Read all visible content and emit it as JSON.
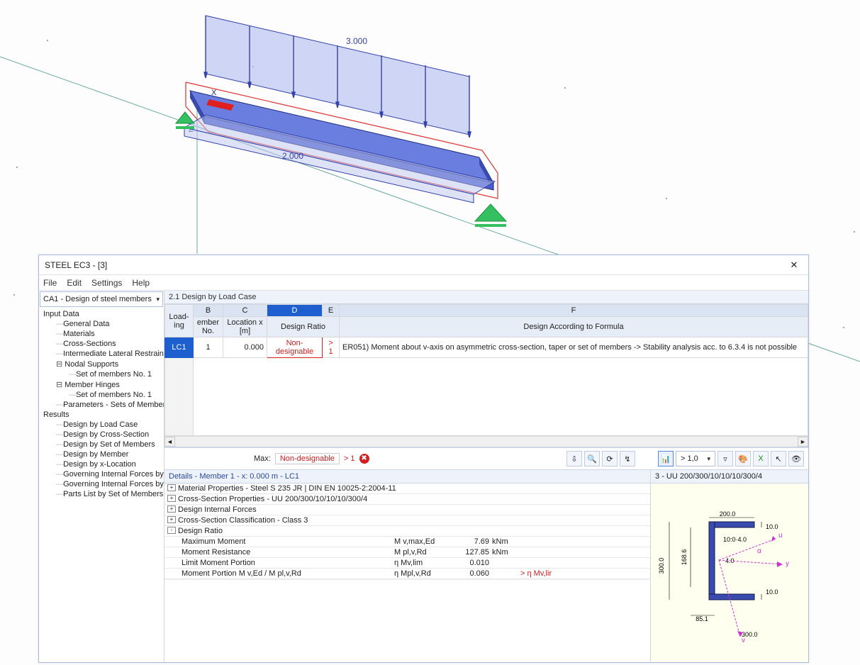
{
  "viewport": {
    "load_value": "3.000",
    "dim_value": "2.000",
    "axis_x": "X",
    "axis_z": "Z"
  },
  "window": {
    "title": "STEEL EC3 - [3]",
    "menus": [
      "File",
      "Edit",
      "Settings",
      "Help"
    ],
    "dropdown": "CA1 - Design of steel members",
    "tree": [
      {
        "label": "Input Data",
        "lvl": 1,
        "type": "plain"
      },
      {
        "label": "General Data",
        "lvl": 2,
        "type": "leaf"
      },
      {
        "label": "Materials",
        "lvl": 2,
        "type": "leaf"
      },
      {
        "label": "Cross-Sections",
        "lvl": 2,
        "type": "leaf"
      },
      {
        "label": "Intermediate Lateral Restraints",
        "lvl": 2,
        "type": "leaf"
      },
      {
        "label": "Nodal Supports",
        "lvl": 2,
        "type": "exp"
      },
      {
        "label": "Set of members No. 1",
        "lvl": 3,
        "type": "leaf"
      },
      {
        "label": "Member Hinges",
        "lvl": 2,
        "type": "exp"
      },
      {
        "label": "Set of members No. 1",
        "lvl": 3,
        "type": "leaf"
      },
      {
        "label": "Parameters - Sets of Members",
        "lvl": 2,
        "type": "leaf"
      },
      {
        "label": "Results",
        "lvl": 1,
        "type": "plain"
      },
      {
        "label": "Design by Load Case",
        "lvl": 2,
        "type": "leaf"
      },
      {
        "label": "Design by Cross-Section",
        "lvl": 2,
        "type": "leaf"
      },
      {
        "label": "Design by Set of Members",
        "lvl": 2,
        "type": "leaf"
      },
      {
        "label": "Design by Member",
        "lvl": 2,
        "type": "leaf"
      },
      {
        "label": "Design by x-Location",
        "lvl": 2,
        "type": "leaf"
      },
      {
        "label": "Governing Internal Forces by M",
        "lvl": 2,
        "type": "leaf"
      },
      {
        "label": "Governing Internal Forces by S",
        "lvl": 2,
        "type": "leaf"
      },
      {
        "label": "Parts List by Set of Members",
        "lvl": 2,
        "type": "leaf"
      }
    ],
    "section_title": "2.1 Design by Load Case",
    "grid": {
      "cols_letters": [
        "B",
        "C",
        "D",
        "E",
        "F"
      ],
      "headers": {
        "loading": "Load-\ning",
        "member": "ember\nNo.",
        "location": "Location\nx [m]",
        "design": "Design\nRatio",
        "formula": "Design According to Formula"
      },
      "row": {
        "load": "LC1",
        "member": "1",
        "x": "0.000",
        "ratio": "Non-designable",
        "gt": "> 1",
        "text": "ER051) Moment about v-axis on asymmetric cross-section, taper or set of members -> Stability analysis acc. to 6.3.4 is not possible"
      }
    },
    "maxbar": {
      "label": "Max:",
      "status": "Non-designable",
      "gt": "> 1",
      "scale": "> 1,0"
    },
    "details": {
      "title": "Details - Member 1 - x: 0.000 m - LC1",
      "nodes": [
        {
          "box": "+",
          "t": "Material Properties - Steel S 235 JR | DIN EN 10025-2:2004-11"
        },
        {
          "box": "+",
          "t": "Cross-Section Properties  -  UU 200/300/10/10/10/300/4"
        },
        {
          "box": "+",
          "t": "Design Internal Forces"
        },
        {
          "box": "+",
          "t": "Cross-Section Classification - Class 3"
        },
        {
          "box": "-",
          "t": "Design Ratio"
        }
      ],
      "rows": [
        {
          "lbl": "Maximum Moment",
          "sym": "M v,max,Ed",
          "val": "7.69",
          "unit": "kNm",
          "cond": ""
        },
        {
          "lbl": "Moment Resistance",
          "sym": "M pl,v,Rd",
          "val": "127.85",
          "unit": "kNm",
          "cond": ""
        },
        {
          "lbl": "Limit Moment Portion",
          "sym": "η Mv,lim",
          "val": "0.010",
          "unit": "",
          "cond": ""
        },
        {
          "lbl": "Moment Portion M v,Ed / M pl,v,Rd",
          "sym": "η Mpl,v,Rd",
          "val": "0.060",
          "unit": "",
          "cond": "> η Mv,lir"
        }
      ]
    },
    "section": {
      "title": "3 - UU 200/300/10/10/10/300/4",
      "dims": {
        "w": "200.0",
        "h": "300.0",
        "t1": "10.0",
        "t2": "10:0·4.0",
        "t3": "10.0",
        "a": "4.0",
        "b1": "85.1",
        "h2": "168.6",
        "bot": "300.0"
      },
      "axes": {
        "u": "u",
        "v": "v",
        "y": "y",
        "alpha": "α"
      }
    }
  }
}
